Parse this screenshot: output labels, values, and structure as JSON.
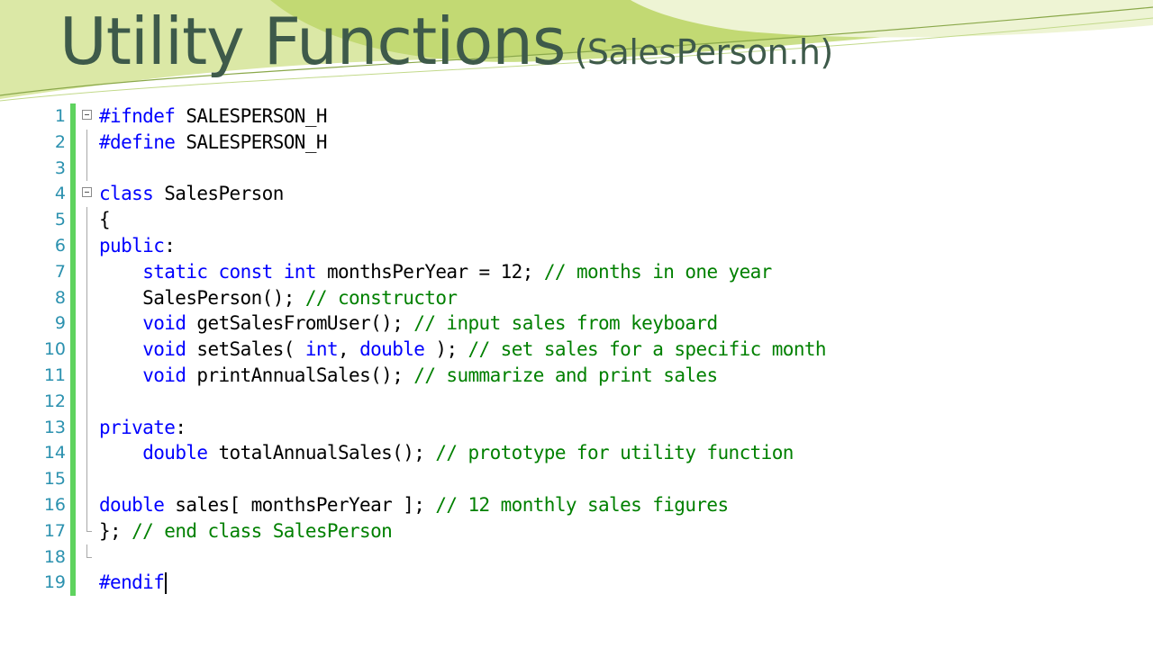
{
  "slide": {
    "title_main": "Utility Functions",
    "title_sub": "(SalesPerson.h)"
  },
  "colors": {
    "title": "#3e5a4a",
    "keyword": "#0000ff",
    "preprocessor": "#0000ff",
    "comment": "#008000",
    "text": "#000000",
    "line_number": "#2b91af",
    "change_bar": "#5fd35f",
    "decor_green": "#a6c83a"
  },
  "editor": {
    "lines": [
      {
        "num": "1",
        "fold": "box",
        "tokens": [
          {
            "t": "#ifndef",
            "c": "keyword"
          },
          {
            "t": " SALESPERSON_H",
            "c": "text"
          }
        ]
      },
      {
        "num": "2",
        "fold": "line",
        "tokens": [
          {
            "t": "#define",
            "c": "keyword"
          },
          {
            "t": " SALESPERSON_H",
            "c": "text"
          }
        ]
      },
      {
        "num": "3",
        "fold": "line",
        "tokens": []
      },
      {
        "num": "4",
        "fold": "box",
        "tokens": [
          {
            "t": "class",
            "c": "keyword"
          },
          {
            "t": " SalesPerson",
            "c": "text"
          }
        ]
      },
      {
        "num": "5",
        "fold": "line",
        "tokens": [
          {
            "t": "{",
            "c": "text"
          }
        ]
      },
      {
        "num": "6",
        "fold": "line",
        "tokens": [
          {
            "t": "public",
            "c": "keyword"
          },
          {
            "t": ":",
            "c": "text"
          }
        ]
      },
      {
        "num": "7",
        "fold": "line",
        "tokens": [
          {
            "t": "    ",
            "c": "text"
          },
          {
            "t": "static",
            "c": "keyword"
          },
          {
            "t": " ",
            "c": "text"
          },
          {
            "t": "const",
            "c": "keyword"
          },
          {
            "t": " ",
            "c": "text"
          },
          {
            "t": "int",
            "c": "keyword"
          },
          {
            "t": " monthsPerYear = 12; ",
            "c": "text"
          },
          {
            "t": "// months in one year",
            "c": "comment"
          }
        ]
      },
      {
        "num": "8",
        "fold": "line",
        "tokens": [
          {
            "t": "    SalesPerson(); ",
            "c": "text"
          },
          {
            "t": "// constructor",
            "c": "comment"
          }
        ]
      },
      {
        "num": "9",
        "fold": "line",
        "tokens": [
          {
            "t": "    ",
            "c": "text"
          },
          {
            "t": "void",
            "c": "keyword"
          },
          {
            "t": " getSalesFromUser(); ",
            "c": "text"
          },
          {
            "t": "// input sales from keyboard",
            "c": "comment"
          }
        ]
      },
      {
        "num": "10",
        "fold": "line",
        "tokens": [
          {
            "t": "    ",
            "c": "text"
          },
          {
            "t": "void",
            "c": "keyword"
          },
          {
            "t": " setSales( ",
            "c": "text"
          },
          {
            "t": "int",
            "c": "keyword"
          },
          {
            "t": ", ",
            "c": "text"
          },
          {
            "t": "double",
            "c": "keyword"
          },
          {
            "t": " ); ",
            "c": "text"
          },
          {
            "t": "// set sales for a specific month",
            "c": "comment"
          }
        ]
      },
      {
        "num": "11",
        "fold": "line",
        "tokens": [
          {
            "t": "    ",
            "c": "text"
          },
          {
            "t": "void",
            "c": "keyword"
          },
          {
            "t": " printAnnualSales(); ",
            "c": "text"
          },
          {
            "t": "// summarize and print sales",
            "c": "comment"
          }
        ]
      },
      {
        "num": "12",
        "fold": "line",
        "tokens": []
      },
      {
        "num": "13",
        "fold": "line",
        "tokens": [
          {
            "t": "private",
            "c": "keyword"
          },
          {
            "t": ":",
            "c": "text"
          }
        ]
      },
      {
        "num": "14",
        "fold": "line",
        "tokens": [
          {
            "t": "    ",
            "c": "text"
          },
          {
            "t": "double",
            "c": "keyword"
          },
          {
            "t": " totalAnnualSales(); ",
            "c": "text"
          },
          {
            "t": "// prototype for utility function",
            "c": "comment"
          }
        ]
      },
      {
        "num": "15",
        "fold": "line",
        "tokens": []
      },
      {
        "num": "16",
        "fold": "line",
        "tokens": [
          {
            "t": "double",
            "c": "keyword"
          },
          {
            "t": " sales[ monthsPerYear ]; ",
            "c": "text"
          },
          {
            "t": "// 12 monthly sales figures",
            "c": "comment"
          }
        ]
      },
      {
        "num": "17",
        "fold": "end",
        "tokens": [
          {
            "t": "}; ",
            "c": "text"
          },
          {
            "t": "// end class SalesPerson",
            "c": "comment"
          }
        ]
      },
      {
        "num": "18",
        "fold": "end",
        "tokens": []
      },
      {
        "num": "19",
        "fold": "none",
        "cursor": true,
        "tokens": [
          {
            "t": "#endif",
            "c": "keyword"
          }
        ]
      }
    ]
  }
}
